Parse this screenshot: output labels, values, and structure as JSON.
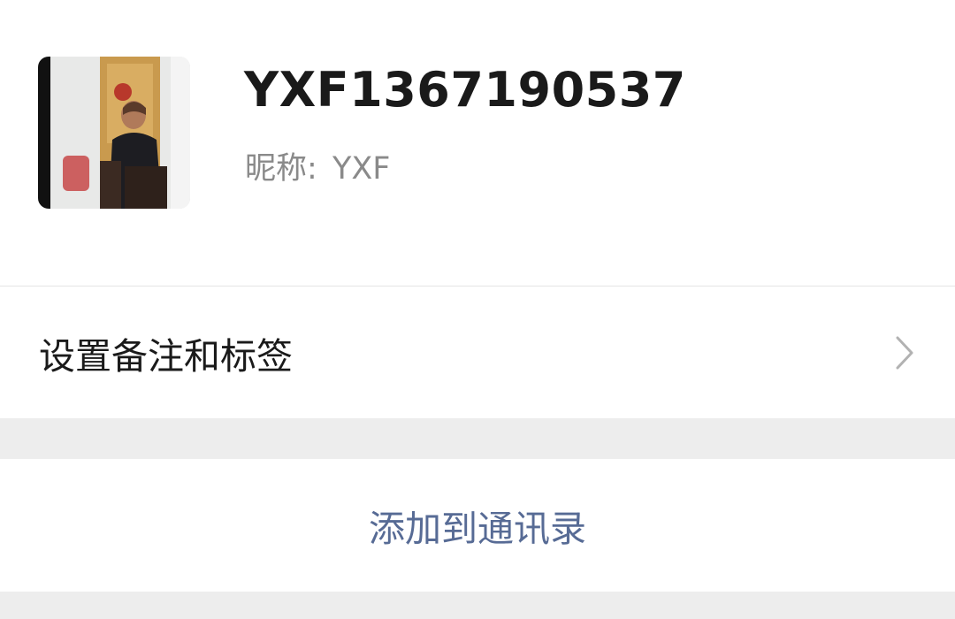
{
  "profile": {
    "display_name": "YXF1367190537",
    "nickname_label": "昵称:",
    "nickname_value": "YXF",
    "avatar_icon": "contact-avatar-photo"
  },
  "remark_row": {
    "label": "设置备注和标签",
    "chevron_icon": "chevron-right-icon"
  },
  "add_contact": {
    "label": "添加到通讯录",
    "color": "#576b95"
  },
  "colors": {
    "background": "#ededed",
    "card": "#ffffff",
    "primary_text": "#1a1a1a",
    "secondary_text": "#8a8a8a"
  }
}
